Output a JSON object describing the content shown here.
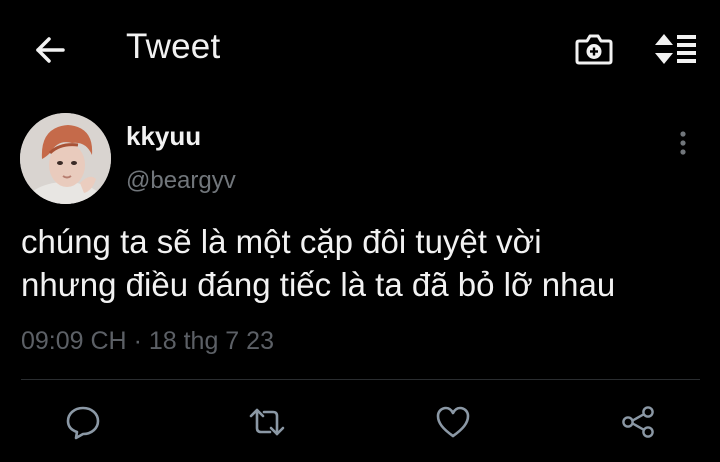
{
  "header": {
    "title": "Tweet",
    "icons": [
      "arrow-left-icon",
      "camera-plus-icon",
      "sort-icon"
    ]
  },
  "tweet": {
    "display_name": "kkyuu",
    "handle": "@beargyv",
    "text": "chúng ta sẽ là một cặp đôi tuyệt vời\nnhưng điều đáng tiếc là ta đã bỏ lỡ nhau",
    "time": "09:09 CH",
    "separator": "·",
    "date": "18 thg 7 23"
  },
  "actions": [
    "reply-icon",
    "retweet-icon",
    "like-icon",
    "share-icon"
  ],
  "colors": {
    "background": "#000000",
    "text": "#f2f2f2",
    "secondary": "#71767b",
    "icon": "#8b98a5"
  }
}
